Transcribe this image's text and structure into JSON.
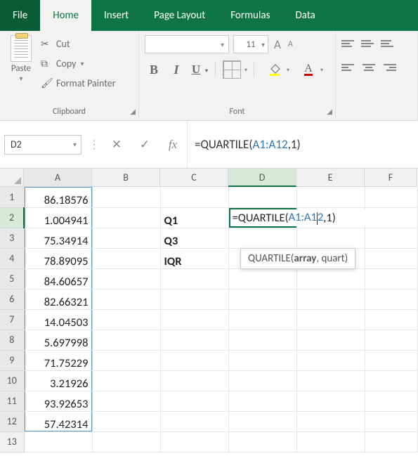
{
  "tabs": {
    "file": "File",
    "home": "Home",
    "insert": "Insert",
    "layout": "Page Layout",
    "formulas": "Formulas",
    "data": "Data"
  },
  "clipboard": {
    "paste": "Paste",
    "cut": "Cut",
    "copy": "Copy",
    "fmt": "Format Painter",
    "group": "Clipboard"
  },
  "font": {
    "size": "11",
    "bold": "B",
    "ital": "I",
    "und": "U",
    "colorA": "A",
    "incA": "A",
    "decA": "A",
    "group": "Font"
  },
  "nameBox": "D2",
  "fbCancel": "✕",
  "fbConfirm": "✓",
  "fx": "fx",
  "formulaPrefix": "=QUARTILE(",
  "formulaRef": "A1:A12",
  "formulaSuffix": ",1)",
  "columns": [
    "A",
    "B",
    "C",
    "D",
    "E",
    "F"
  ],
  "rows": {
    "1": {
      "A": "86.18576"
    },
    "2": {
      "A": "1.004941",
      "C": "Q1",
      "D_prefix": "=QUARTILE(",
      "D_ref": "A1:A1",
      "D_caret_after": "2",
      "D_suffix": ",1)"
    },
    "3": {
      "A": "75.34914",
      "C": "Q3"
    },
    "4": {
      "A": "78.89095",
      "C": "IQR"
    },
    "5": {
      "A": "84.60657"
    },
    "6": {
      "A": "82.66321"
    },
    "7": {
      "A": "14.04503"
    },
    "8": {
      "A": "5.697998"
    },
    "9": {
      "A": "71.75229"
    },
    "10": {
      "A": "3.21926"
    },
    "11": {
      "A": "93.92653"
    },
    "12": {
      "A": "57.42314"
    }
  },
  "tooltip": {
    "fn": "QUARTILE(",
    "arg1": "array",
    "rest": ", quart)"
  }
}
